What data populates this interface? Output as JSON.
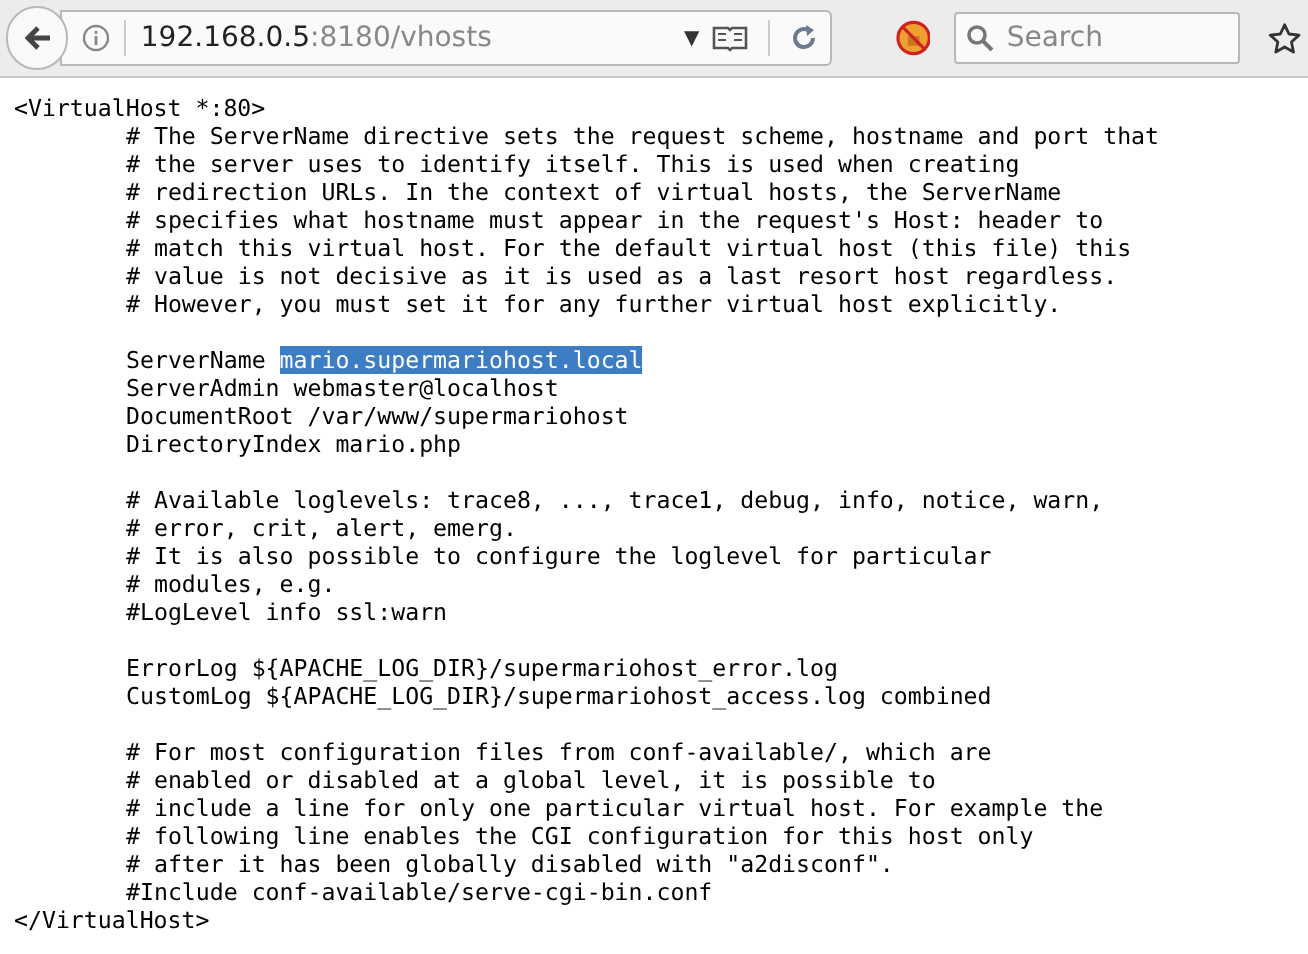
{
  "toolbar": {
    "url": {
      "host": "192.168.0.5",
      "rest": ":8180/vhosts"
    },
    "dropdown_glyph": "▼",
    "search": {
      "placeholder": "Search"
    }
  },
  "document": {
    "open_tag": "<VirtualHost *:80>",
    "close_tag": "</VirtualHost>",
    "groups": [
      [
        {
          "text": "# The ServerName directive sets the request scheme, hostname and port that"
        },
        {
          "text": "# the server uses to identify itself. This is used when creating"
        },
        {
          "text": "# redirection URLs. In the context of virtual hosts, the ServerName"
        },
        {
          "text": "# specifies what hostname must appear in the request's Host: header to"
        },
        {
          "text": "# match this virtual host. For the default virtual host (this file) this"
        },
        {
          "text": "# value is not decisive as it is used as a last resort host regardless."
        },
        {
          "text": "# However, you must set it for any further virtual host explicitly."
        }
      ],
      [
        {
          "text": "ServerName ",
          "selected_text": "mario.supermariohost.local"
        },
        {
          "text": "ServerAdmin webmaster@localhost"
        },
        {
          "text": "DocumentRoot /var/www/supermariohost"
        },
        {
          "text": "DirectoryIndex mario.php"
        }
      ],
      [
        {
          "text": "# Available loglevels: trace8, ..., trace1, debug, info, notice, warn,"
        },
        {
          "text": "# error, crit, alert, emerg."
        },
        {
          "text": "# It is also possible to configure the loglevel for particular"
        },
        {
          "text": "# modules, e.g."
        },
        {
          "text": "#LogLevel info ssl:warn"
        }
      ],
      [
        {
          "text": "ErrorLog ${APACHE_LOG_DIR}/supermariohost_error.log"
        },
        {
          "text": "CustomLog ${APACHE_LOG_DIR}/supermariohost_access.log combined"
        }
      ],
      [
        {
          "text": "# For most configuration files from conf-available/, which are"
        },
        {
          "text": "# enabled or disabled at a global level, it is possible to"
        },
        {
          "text": "# include a line for only one particular virtual host. For example the"
        },
        {
          "text": "# following line enables the CGI configuration for this host only"
        },
        {
          "text": "# after it has been globally disabled with \"a2disconf\"."
        },
        {
          "text": "#Include conf-available/serve-cgi-bin.conf"
        }
      ]
    ]
  }
}
